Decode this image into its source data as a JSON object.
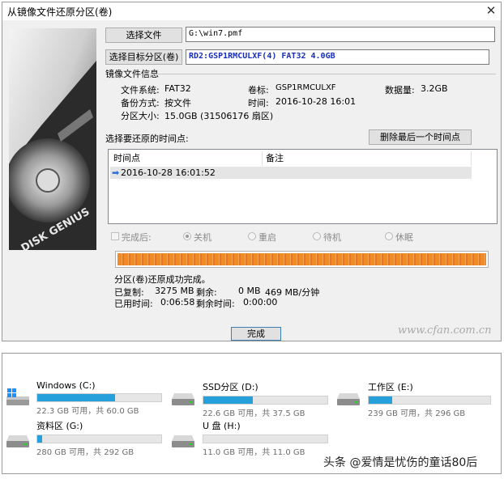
{
  "dialog": {
    "title": "从镜像文件还原分区(卷)",
    "close_symbol": "✕",
    "select_file_button": "选择文件",
    "file_path": "G:\\win7.pmf",
    "select_target_button": "选择目标分区(卷)",
    "target_partition": "RD2:GSP1RMCULXF(4) FAT32 4.0GB",
    "target_color": "#1a2fb5",
    "image_info_heading": "镜像文件信息",
    "info": {
      "fs_label": "文件系统:",
      "fs_value": "FAT32",
      "volume_label": "卷标:",
      "volume_value": "GSP1RMCULXF",
      "data_label": "数据量:",
      "data_value": "3.2GB",
      "backup_label": "备份方式:",
      "backup_value": "按文件",
      "time_label": "时间:",
      "time_value": "2016-10-28 16:01",
      "size_label": "分区大小:",
      "size_value": "15.0GB  (31506176 扇区)"
    },
    "timepoint_heading": "选择要还原的时间点:",
    "delete_last_button": "删除最后一个时间点",
    "columns": [
      "时间点",
      "备注"
    ],
    "timepoints": [
      {
        "time": "2016-10-28 16:01:52",
        "note": ""
      }
    ],
    "after_done_label": "完成后:",
    "options": [
      "关机",
      "重启",
      "待机",
      "休眠"
    ],
    "progress_percent": 100,
    "status_text": "分区(卷)还原成功完成。",
    "copied_label": "已复制:",
    "copied_value": "3275 MB",
    "remaining_label": "剩余:",
    "remaining_value": "0 MB",
    "speed_value": "469 MB/分钟",
    "elapsed_label": "已用时间:",
    "elapsed_value": "0:06:58",
    "left_time_label": "剩余时间:",
    "left_time_value": "0:00:00",
    "finish_button": "完成",
    "disk_brand": "DISK GENIUS",
    "watermark": "www.cfan.com.cn"
  },
  "explorer": {
    "accent": "#26a0da",
    "drives": [
      {
        "name": "Windows (C:)",
        "info": "22.3 GB 可用，共 60.0 GB",
        "used_fraction": 0.63,
        "icon": "windows-drive-icon"
      },
      {
        "name": "SSD分区 (D:)",
        "info": "22.6 GB 可用，共 37.5 GB",
        "used_fraction": 0.4,
        "icon": "drive-icon"
      },
      {
        "name": "工作区 (E:)",
        "info": "239 GB 可用，共 296 GB",
        "used_fraction": 0.19,
        "icon": "drive-icon"
      },
      {
        "name": "资料区 (G:)",
        "info": "280 GB 可用，共 292 GB",
        "used_fraction": 0.04,
        "icon": "drive-icon"
      },
      {
        "name": "U 盘 (H:)",
        "info": "11.0 GB 可用，共 11.0 GB",
        "used_fraction": 0.0,
        "icon": "usb-drive-icon"
      }
    ],
    "watermark": "头条 @爱情是忧伤的童话80后"
  }
}
